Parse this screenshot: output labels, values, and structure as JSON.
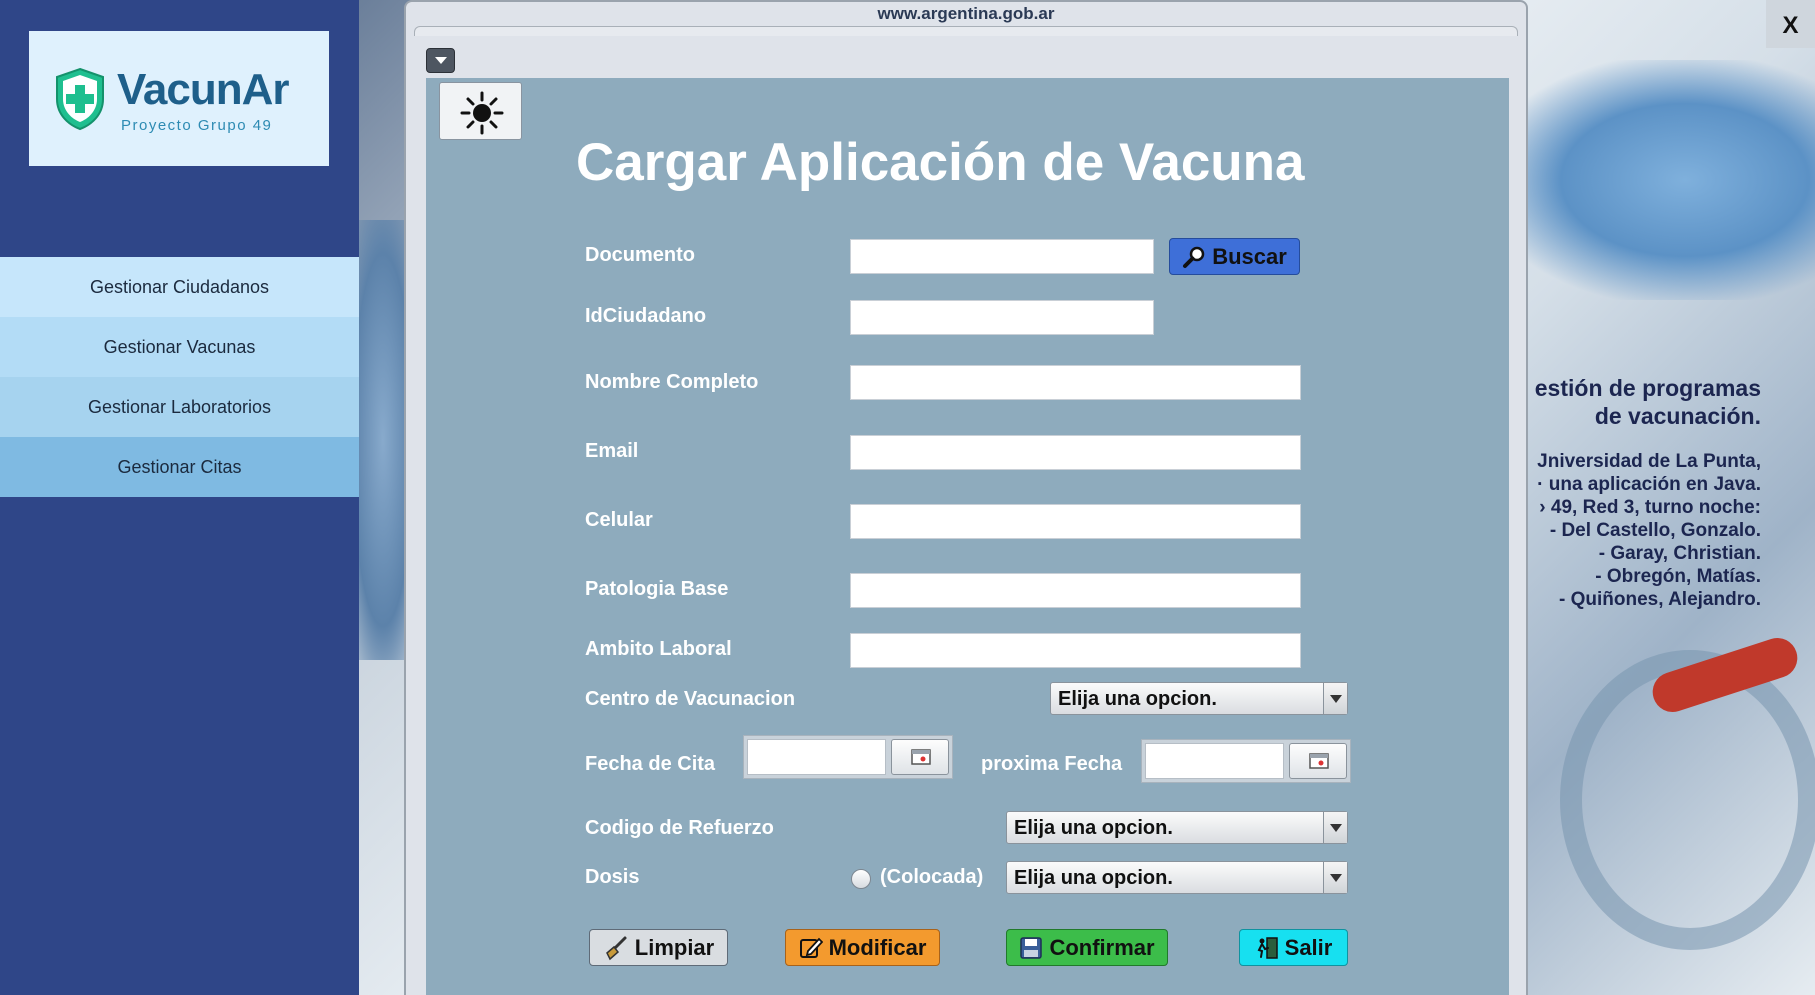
{
  "colors": {
    "sidebar_bg": "#2f4688",
    "panel_bg": "#8eabbd",
    "buscar_btn": "#3e6fd8",
    "limpiar_btn": "#d9dde1",
    "modificar_btn": "#f39a2e",
    "confirmar_btn": "#3cbd4a",
    "salir_btn": "#17e0f0"
  },
  "logo": {
    "title": "VacunAr",
    "subtitle": "Proyecto Grupo 49"
  },
  "sidebar": {
    "items": [
      {
        "label": "Gestionar Ciudadanos"
      },
      {
        "label": "Gestionar Vacunas"
      },
      {
        "label": "Gestionar Laboratorios"
      },
      {
        "label": "Gestionar Citas"
      }
    ]
  },
  "background": {
    "heading_line1": "estión de programas",
    "heading_line2": "de vacunación.",
    "lines": [
      "Jniversidad de La Punta,",
      "· una aplicación en Java.",
      "› 49, Red 3, turno noche:",
      "- Del Castello, Gonzalo.",
      "- Garay, Christian.",
      "- Obregón, Matías.",
      "- Quiñones, Alejandro."
    ]
  },
  "window": {
    "close_label": "X",
    "frame_title": "www.argentina.gob.ar"
  },
  "form": {
    "title": "Cargar Aplicación de Vacuna",
    "labels": {
      "documento": "Documento",
      "id_ciudadano": "IdCiudadano",
      "nombre_completo": "Nombre Completo",
      "email": "Email",
      "celular": "Celular",
      "patologia_base": "Patologia Base",
      "ambito_laboral": "Ambito Laboral",
      "centro_vacunacion": "Centro de Vacunacion",
      "fecha_cita": "Fecha de Cita",
      "proxima_fecha": "proxima Fecha",
      "codigo_refuerzo": "Codigo de Refuerzo",
      "dosis": "Dosis",
      "colocada": "(Colocada)"
    },
    "values": {
      "documento": "",
      "id_ciudadano": "",
      "nombre_completo": "",
      "email": "",
      "celular": "",
      "patologia_base": "",
      "ambito_laboral": "",
      "fecha_cita": "",
      "proxima_fecha": ""
    },
    "combos": {
      "centro_vacunacion": "Elija una opcion.",
      "codigo_refuerzo": "Elija una opcion.",
      "dosis": "Elija una opcion."
    },
    "colocada_checked": false,
    "buttons": {
      "buscar": "Buscar",
      "limpiar": "Limpiar",
      "modificar": "Modificar",
      "confirmar": "Confirmar",
      "salir": "Salir"
    }
  }
}
